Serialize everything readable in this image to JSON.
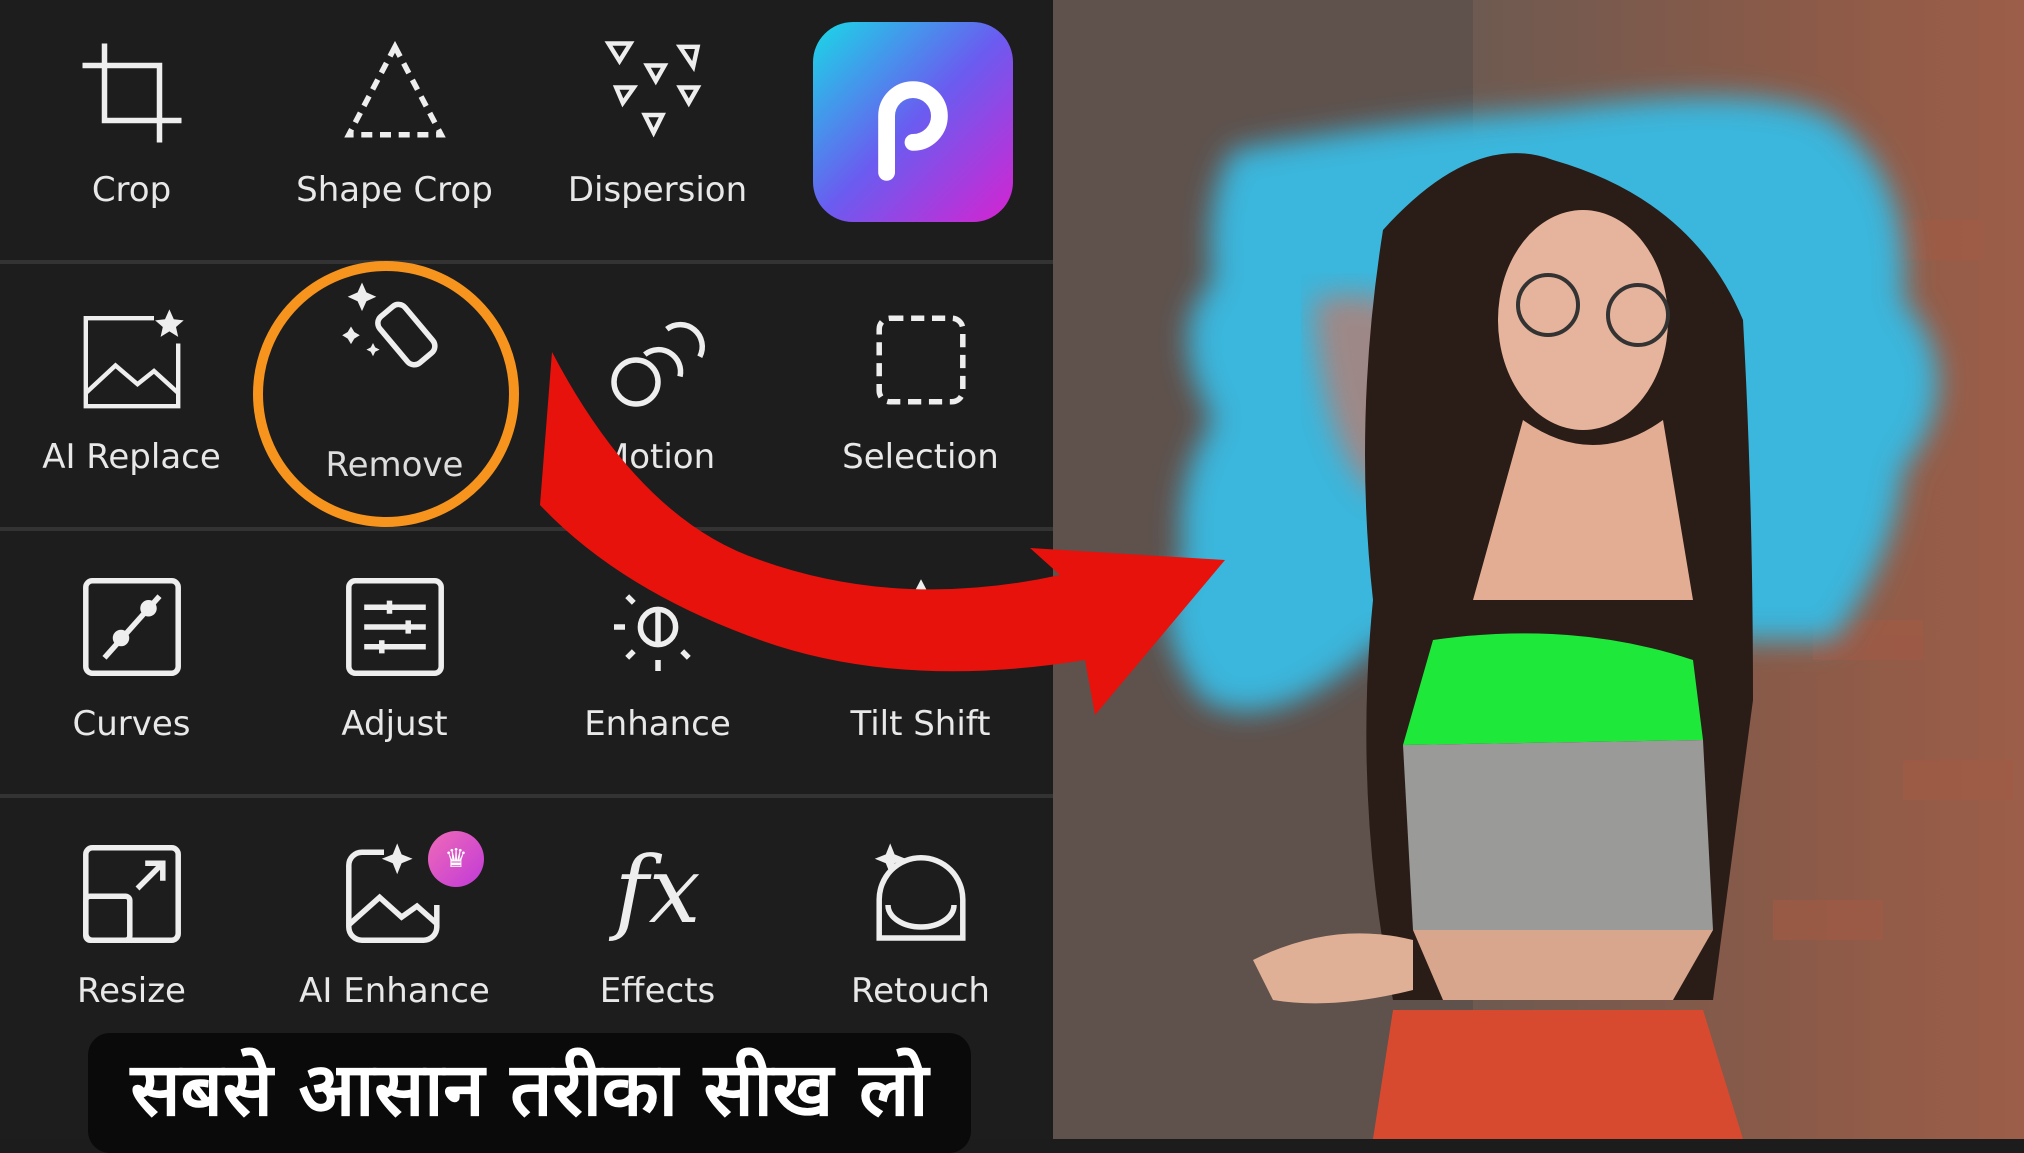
{
  "tools": [
    {
      "label": "Crop",
      "icon": "crop-icon"
    },
    {
      "label": "Shape Crop",
      "icon": "shape-crop-icon"
    },
    {
      "label": "Dispersion",
      "icon": "dispersion-icon"
    },
    {
      "label": "AI Replace",
      "icon": "ai-replace-icon"
    },
    {
      "label": "Remove",
      "icon": "eraser-icon"
    },
    {
      "label": "Motion",
      "icon": "motion-icon"
    },
    {
      "label": "Selection",
      "icon": "selection-icon"
    },
    {
      "label": "Curves",
      "icon": "curves-icon"
    },
    {
      "label": "Adjust",
      "icon": "adjust-icon"
    },
    {
      "label": "Enhance",
      "icon": "enhance-icon"
    },
    {
      "label": "Tilt Shift",
      "icon": "tilt-shift-icon"
    },
    {
      "label": "Resize",
      "icon": "resize-icon"
    },
    {
      "label": "AI Enhance",
      "icon": "ai-enhance-icon"
    },
    {
      "label": "Effects",
      "icon": "fx-icon"
    },
    {
      "label": "Retouch",
      "icon": "retouch-icon"
    }
  ],
  "logo": {
    "letter": "P",
    "icon": "picsart-logo"
  },
  "banner": {
    "text": "सबसे आसान तरीका सीख लो"
  },
  "colors": {
    "highlight_ring": "#f7941d",
    "arrow": "#e8120c",
    "logo_gradient": [
      "#19d9e6",
      "#d623d0"
    ]
  }
}
